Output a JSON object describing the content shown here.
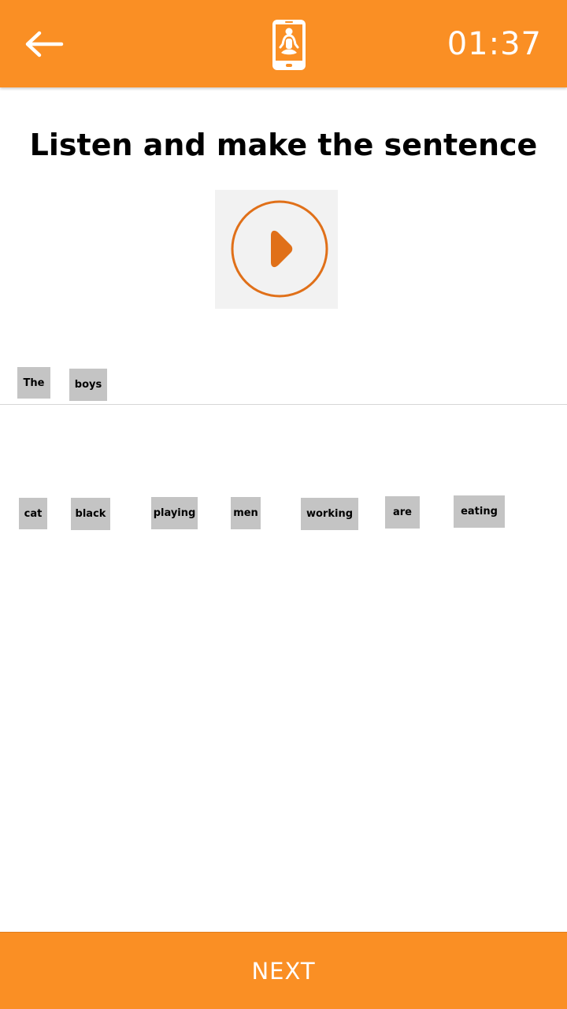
{
  "header": {
    "back_icon": "arrow-left-icon",
    "app_icon": "phone-meditation-icon",
    "timer": "01:37"
  },
  "title": "Listen and make the sentence",
  "play_icon": "play-icon",
  "colors": {
    "accent": "#fa8f24",
    "play": "#e07019",
    "chip": "#c4c4c4"
  },
  "answer_words": [
    "The",
    "boys"
  ],
  "word_bank": [
    "cat",
    "black",
    "playing",
    "men",
    "working",
    "are",
    "eating"
  ],
  "footer": {
    "next_label": "NEXT"
  }
}
